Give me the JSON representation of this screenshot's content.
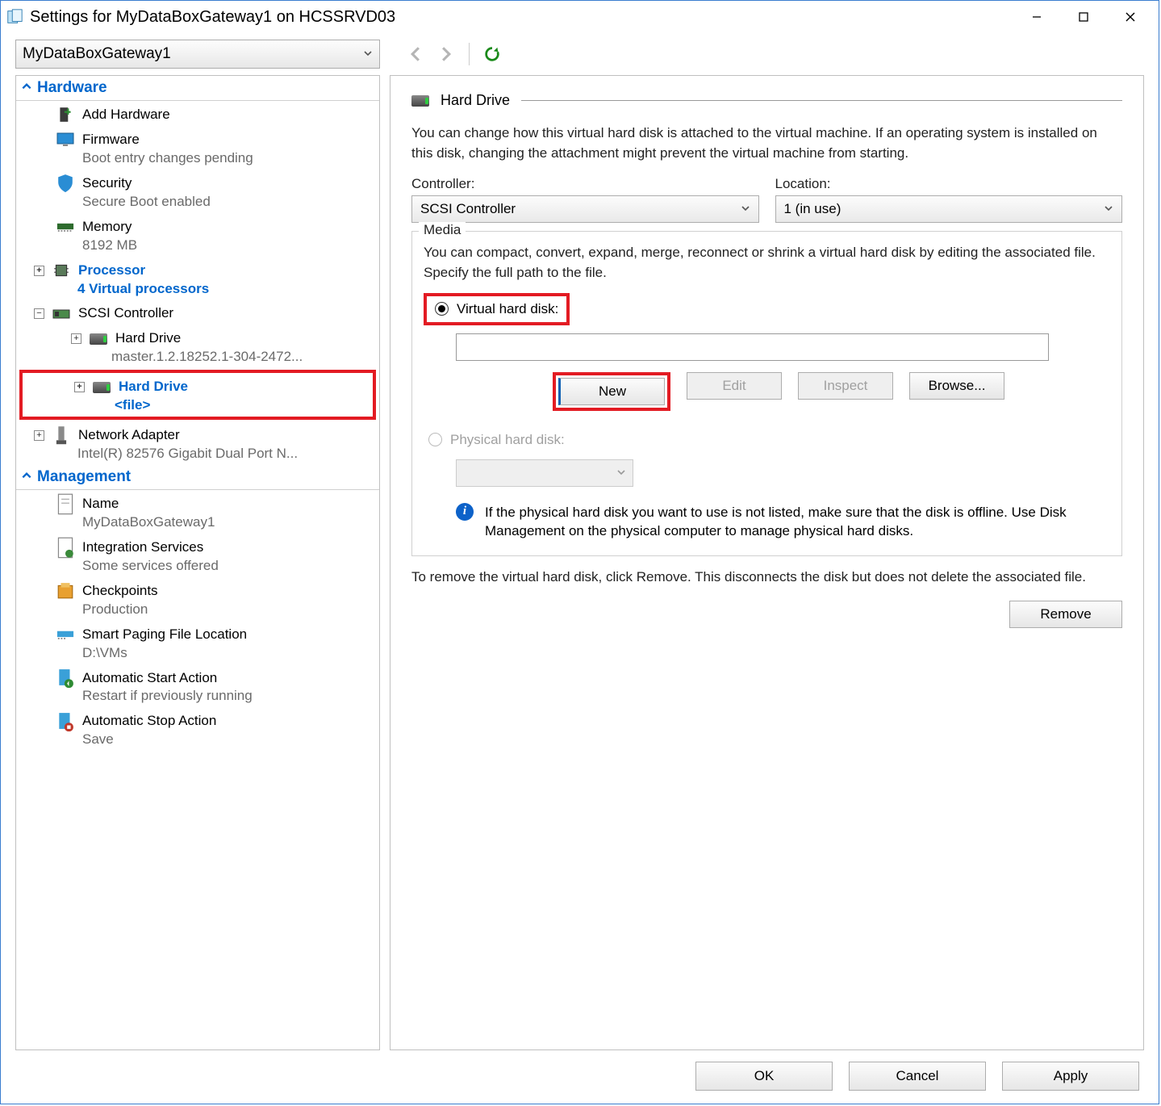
{
  "window_title": "Settings for MyDataBoxGateway1 on HCSSRVD03",
  "vm_selector": "MyDataBoxGateway1",
  "sidebar": {
    "hardware_header": "Hardware",
    "management_header": "Management",
    "add_hardware": "Add Hardware",
    "firmware": {
      "label": "Firmware",
      "sub": "Boot entry changes pending"
    },
    "security": {
      "label": "Security",
      "sub": "Secure Boot enabled"
    },
    "memory": {
      "label": "Memory",
      "sub": "8192 MB"
    },
    "processor": {
      "label": "Processor",
      "sub": "4 Virtual processors"
    },
    "scsi": {
      "label": "SCSI Controller"
    },
    "hd1": {
      "label": "Hard Drive",
      "sub": "master.1.2.18252.1-304-2472..."
    },
    "hd2": {
      "label": "Hard Drive",
      "sub": "<file>"
    },
    "network": {
      "label": "Network Adapter",
      "sub": "Intel(R) 82576 Gigabit Dual Port N..."
    },
    "name": {
      "label": "Name",
      "sub": "MyDataBoxGateway1"
    },
    "integration": {
      "label": "Integration Services",
      "sub": "Some services offered"
    },
    "checkpoints": {
      "label": "Checkpoints",
      "sub": "Production"
    },
    "paging": {
      "label": "Smart Paging File Location",
      "sub": "D:\\VMs"
    },
    "autostart": {
      "label": "Automatic Start Action",
      "sub": "Restart if previously running"
    },
    "autostop": {
      "label": "Automatic Stop Action",
      "sub": "Save"
    }
  },
  "panel": {
    "title": "Hard Drive",
    "description": "You can change how this virtual hard disk is attached to the virtual machine. If an operating system is installed on this disk, changing the attachment might prevent the virtual machine from starting.",
    "controller_label": "Controller:",
    "controller_value": "SCSI Controller",
    "location_label": "Location:",
    "location_value": "1 (in use)",
    "media_legend": "Media",
    "media_desc": "You can compact, convert, expand, merge, reconnect or shrink a virtual hard disk by editing the associated file. Specify the full path to the file.",
    "vhd_radio": "Virtual hard disk:",
    "phys_radio": "Physical hard disk:",
    "btn_new": "New",
    "btn_edit": "Edit",
    "btn_inspect": "Inspect",
    "btn_browse": "Browse...",
    "phys_info": "If the physical hard disk you want to use is not listed, make sure that the disk is offline. Use Disk Management on the physical computer to manage physical hard disks.",
    "remove_desc": "To remove the virtual hard disk, click Remove. This disconnects the disk but does not delete the associated file.",
    "btn_remove": "Remove"
  },
  "footer": {
    "ok": "OK",
    "cancel": "Cancel",
    "apply": "Apply"
  }
}
